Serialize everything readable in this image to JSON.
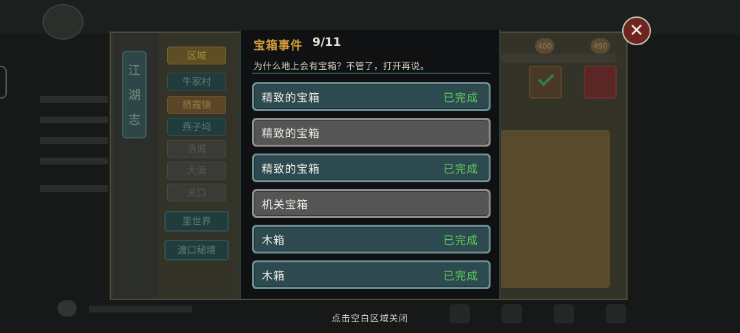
{
  "background": {
    "sidebar_title": [
      "江",
      "湖",
      "志"
    ],
    "tabs": [
      {
        "label": "区域",
        "style": "gold"
      },
      {
        "label": "牛家村",
        "style": "teal"
      },
      {
        "label": "栖霞镇",
        "style": "ochre"
      },
      {
        "label": "燕子坞",
        "style": "teal"
      },
      {
        "label": "洛城",
        "style": "dim"
      },
      {
        "label": "大漠",
        "style": "dim"
      },
      {
        "label": "关口",
        "style": "dim"
      }
    ],
    "special_tabs": [
      "里世界",
      "渡口秘境"
    ],
    "coins": [
      "400",
      "490"
    ]
  },
  "panel": {
    "title": "宝箱事件",
    "count": "9/11",
    "description": "为什么地上会有宝箱？不管了，打开再说。",
    "rows": [
      {
        "name": "精致的宝箱",
        "status": "已完成",
        "done": true
      },
      {
        "name": "精致的宝箱",
        "status": "",
        "done": false
      },
      {
        "name": "精致的宝箱",
        "status": "已完成",
        "done": true
      },
      {
        "name": "机关宝箱",
        "status": "",
        "done": false
      },
      {
        "name": "木箱",
        "status": "已完成",
        "done": true
      },
      {
        "name": "木箱",
        "status": "已完成",
        "done": true
      }
    ]
  },
  "footer_hint": "点击空白区域关闭",
  "colors": {
    "title_gold": "#d69b3a",
    "done_green": "#61d05a",
    "done_row": "#2d4a50",
    "todo_row": "#555555"
  },
  "icons": {
    "close": "close-icon",
    "check": "check-icon"
  }
}
